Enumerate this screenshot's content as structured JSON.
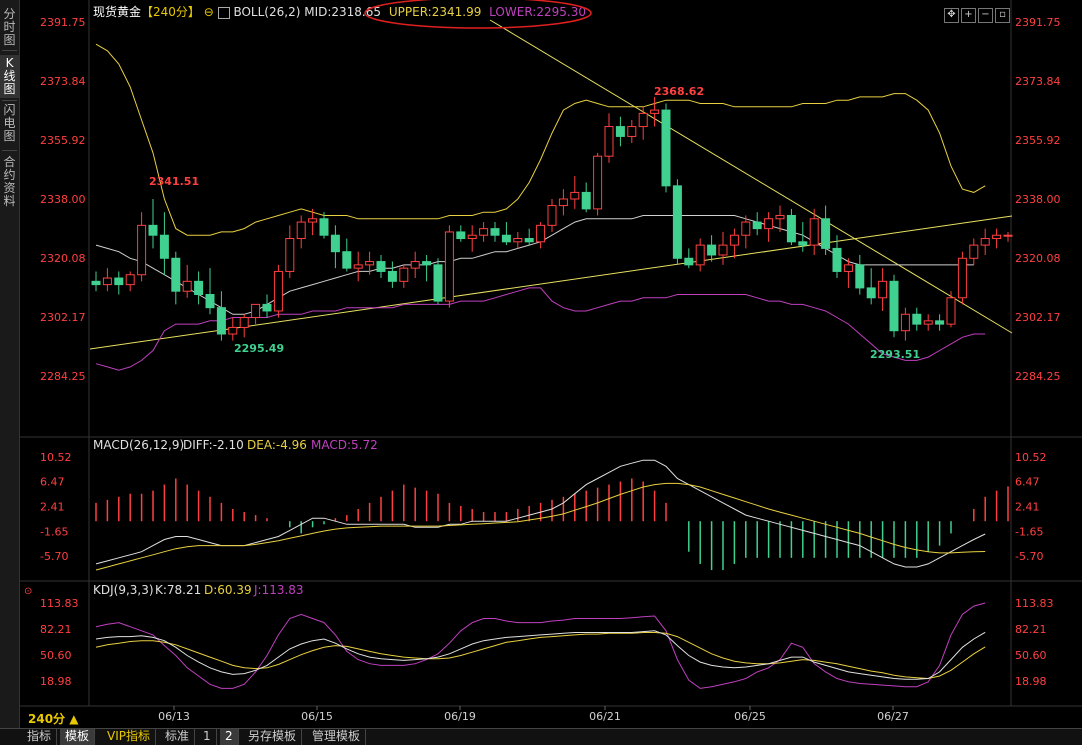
{
  "sidebar": {
    "tabs": [
      {
        "label": "分时图",
        "active": false
      },
      {
        "label": "K线图",
        "active": true
      },
      {
        "label": "闪电图",
        "active": false
      },
      {
        "label": "合约资料",
        "active": false
      }
    ]
  },
  "header": {
    "symbol": "现货黄金",
    "period_tag": "【240分】",
    "indicator": "BOLL(26,2)",
    "mid": "MID:2318.65",
    "upper": "UPPER:2341.99",
    "lower": "LOWER:2295.30"
  },
  "toolbar_icons": [
    "move-icon",
    "zoom-in-icon",
    "zoom-out-icon",
    "restore-icon"
  ],
  "price_axis": {
    "labels": [
      "2391.75",
      "2373.84",
      "2355.92",
      "2338.00",
      "2320.08",
      "2302.17",
      "2284.25"
    ]
  },
  "annotations": {
    "high1": "2341.51",
    "low1": "2295.49",
    "high2": "2368.62",
    "low2": "2293.51"
  },
  "macd": {
    "title": "MACD(26,12,9)",
    "diff": "DIFF:-2.10",
    "dea": "DEA:-4.96",
    "macd": "MACD:5.72",
    "labels": [
      "10.52",
      "6.47",
      "2.41",
      "-1.65",
      "-5.70"
    ]
  },
  "kdj": {
    "title": "KDJ(9,3,3)",
    "k": "K:78.21",
    "d": "D:60.39",
    "j": "J:113.83",
    "labels": [
      "113.83",
      "82.21",
      "50.60",
      "18.98"
    ]
  },
  "x_axis": {
    "labels": [
      "06/13",
      "06/15",
      "06/19",
      "06/21",
      "06/25",
      "06/27"
    ]
  },
  "period_selector": "240分 ▲",
  "bottom_tabs": [
    {
      "label": "指标",
      "active": false
    },
    {
      "label": "模板",
      "active": true
    },
    {
      "label": "VIP指标",
      "active": false
    },
    {
      "label": "标准",
      "active": false
    },
    {
      "label": "1",
      "active": false
    },
    {
      "label": "2",
      "active": true
    },
    {
      "label": "另存模板",
      "active": false
    },
    {
      "label": "管理模板",
      "active": false
    }
  ],
  "colors": {
    "up": "#ff4040",
    "down": "#40d090",
    "upper_band": "#e8d040",
    "lower_band": "#c040c0",
    "mid_band": "#d0d0d0",
    "trendline": "#e8e060",
    "axis_text": "#ff4040"
  },
  "chart_data": {
    "type": "candlestick",
    "price_range": [
      2284.25,
      2391.75
    ],
    "candles": [
      [
        2313,
        2316,
        2310,
        2312
      ],
      [
        2312,
        2317,
        2310,
        2314
      ],
      [
        2314,
        2316,
        2309,
        2312
      ],
      [
        2312,
        2316,
        2310,
        2315
      ],
      [
        2315,
        2334,
        2313,
        2330
      ],
      [
        2330,
        2338,
        2323,
        2327
      ],
      [
        2327,
        2334,
        2315,
        2320
      ],
      [
        2320,
        2322,
        2306,
        2310
      ],
      [
        2310,
        2318,
        2308,
        2313
      ],
      [
        2313,
        2316,
        2306,
        2309
      ],
      [
        2309,
        2317,
        2303,
        2305
      ],
      [
        2305,
        2310,
        2295,
        2297
      ],
      [
        2297,
        2302,
        2295,
        2299
      ],
      [
        2299,
        2303,
        2296,
        2302
      ],
      [
        2302,
        2306,
        2300,
        2306
      ],
      [
        2306,
        2309,
        2302,
        2304
      ],
      [
        2304,
        2318,
        2302,
        2316
      ],
      [
        2316,
        2330,
        2314,
        2326
      ],
      [
        2326,
        2333,
        2323,
        2331
      ],
      [
        2331,
        2335,
        2327,
        2332
      ],
      [
        2332,
        2334,
        2326,
        2327
      ],
      [
        2327,
        2330,
        2317,
        2322
      ],
      [
        2322,
        2326,
        2316,
        2317
      ],
      [
        2317,
        2322,
        2313,
        2318
      ],
      [
        2318,
        2322,
        2315,
        2319
      ],
      [
        2319,
        2321,
        2314,
        2316
      ],
      [
        2316,
        2319,
        2311,
        2313
      ],
      [
        2313,
        2318,
        2311,
        2317
      ],
      [
        2317,
        2322,
        2314,
        2319
      ],
      [
        2319,
        2321,
        2313,
        2318
      ],
      [
        2318,
        2320,
        2306,
        2307
      ],
      [
        2307,
        2330,
        2305,
        2328
      ],
      [
        2328,
        2330,
        2325,
        2326
      ],
      [
        2326,
        2330,
        2322,
        2327
      ],
      [
        2327,
        2331,
        2325,
        2329
      ],
      [
        2329,
        2331,
        2325,
        2327
      ],
      [
        2327,
        2331,
        2324,
        2325
      ],
      [
        2325,
        2328,
        2323,
        2326
      ],
      [
        2326,
        2329,
        2324,
        2325
      ],
      [
        2325,
        2331,
        2323,
        2330
      ],
      [
        2330,
        2338,
        2328,
        2336
      ],
      [
        2336,
        2341,
        2333,
        2338
      ],
      [
        2338,
        2345,
        2335,
        2340
      ],
      [
        2340,
        2343,
        2334,
        2335
      ],
      [
        2335,
        2352,
        2333,
        2351
      ],
      [
        2351,
        2364,
        2349,
        2360
      ],
      [
        2360,
        2363,
        2354,
        2357
      ],
      [
        2357,
        2362,
        2355,
        2360
      ],
      [
        2360,
        2366,
        2356,
        2364
      ],
      [
        2364,
        2369,
        2360,
        2365
      ],
      [
        2365,
        2367,
        2340,
        2342
      ],
      [
        2342,
        2344,
        2318,
        2320
      ],
      [
        2320,
        2323,
        2317,
        2318
      ],
      [
        2318,
        2326,
        2316,
        2324
      ],
      [
        2324,
        2327,
        2319,
        2321
      ],
      [
        2321,
        2328,
        2318,
        2324
      ],
      [
        2324,
        2329,
        2320,
        2327
      ],
      [
        2327,
        2333,
        2323,
        2331
      ],
      [
        2331,
        2334,
        2327,
        2329
      ],
      [
        2329,
        2334,
        2325,
        2332
      ],
      [
        2332,
        2336,
        2328,
        2333
      ],
      [
        2333,
        2335,
        2324,
        2325
      ],
      [
        2325,
        2331,
        2322,
        2324
      ],
      [
        2324,
        2335,
        2321,
        2332
      ],
      [
        2332,
        2336,
        2321,
        2323
      ],
      [
        2323,
        2327,
        2314,
        2316
      ],
      [
        2316,
        2320,
        2311,
        2318
      ],
      [
        2318,
        2321,
        2309,
        2311
      ],
      [
        2311,
        2317,
        2306,
        2308
      ],
      [
        2308,
        2317,
        2304,
        2313
      ],
      [
        2313,
        2315,
        2296,
        2298
      ],
      [
        2298,
        2305,
        2295,
        2303
      ],
      [
        2303,
        2305,
        2298,
        2300
      ],
      [
        2300,
        2303,
        2298,
        2301
      ],
      [
        2301,
        2303,
        2298,
        2300
      ],
      [
        2300,
        2310,
        2299,
        2308
      ],
      [
        2308,
        2322,
        2306,
        2320
      ],
      [
        2320,
        2326,
        2318,
        2324
      ],
      [
        2324,
        2329,
        2321,
        2326
      ],
      [
        2326,
        2329,
        2323,
        2327
      ],
      [
        2327,
        2328,
        2325,
        2327
      ]
    ],
    "boll_upper": [
      2385,
      2383,
      2379,
      2372,
      2362,
      2352,
      2338,
      2329,
      2327,
      2327,
      2327,
      2328,
      2328,
      2329,
      2331,
      2332,
      2333,
      2334,
      2335,
      2334,
      2333,
      2333,
      2333,
      2332,
      2332,
      2332,
      2332,
      2332,
      2332,
      2332,
      2332,
      2333,
      2333,
      2333,
      2334,
      2334,
      2335,
      2338,
      2343,
      2350,
      2358,
      2365,
      2367,
      2368,
      2367,
      2366,
      2366,
      2366,
      2366,
      2367,
      2368,
      2368,
      2368,
      2367,
      2367,
      2367,
      2366,
      2366,
      2366,
      2366,
      2366,
      2366,
      2367,
      2367,
      2367,
      2368,
      2368,
      2369,
      2369,
      2369,
      2370,
      2370,
      2368,
      2365,
      2358,
      2348,
      2341,
      2340,
      2342
    ],
    "boll_mid": [
      2324,
      2323,
      2322,
      2320,
      2319,
      2317,
      2315,
      2313,
      2311,
      2309,
      2307,
      2305,
      2303,
      2303,
      2304,
      2306,
      2308,
      2310,
      2311,
      2312,
      2313,
      2314,
      2315,
      2316,
      2316,
      2317,
      2317,
      2318,
      2318,
      2318,
      2319,
      2319,
      2320,
      2320,
      2321,
      2322,
      2322,
      2323,
      2324,
      2325,
      2327,
      2329,
      2331,
      2332,
      2332,
      2332,
      2332,
      2332,
      2333,
      2333,
      2333,
      2333,
      2333,
      2333,
      2333,
      2333,
      2333,
      2332,
      2331,
      2330,
      2329,
      2328,
      2327,
      2325,
      2323,
      2321,
      2319,
      2318,
      2318,
      2318,
      2318,
      2318,
      2318,
      2318,
      2318,
      2318,
      2318,
      2318
    ],
    "boll_lower": [
      2288,
      2287,
      2286,
      2287,
      2289,
      2292,
      2298,
      2300,
      2300,
      2300,
      2301,
      2301,
      2302,
      2302,
      2302,
      2302,
      2303,
      2303,
      2303,
      2304,
      2304,
      2304,
      2305,
      2305,
      2305,
      2305,
      2305,
      2306,
      2306,
      2306,
      2306,
      2306,
      2307,
      2307,
      2307,
      2308,
      2309,
      2310,
      2311,
      2311,
      2307,
      2305,
      2304,
      2304,
      2305,
      2306,
      2307,
      2307,
      2308,
      2308,
      2308,
      2309,
      2309,
      2309,
      2309,
      2309,
      2309,
      2309,
      2308,
      2307,
      2307,
      2306,
      2306,
      2305,
      2304,
      2302,
      2300,
      2297,
      2294,
      2291,
      2290,
      2289,
      2289,
      2290,
      2292,
      2294,
      2296,
      2297,
      2297
    ],
    "macd_hist": [
      3,
      3.5,
      4,
      4.5,
      4.5,
      5,
      6,
      7,
      6,
      5,
      4,
      3,
      2,
      1.5,
      1,
      0.5,
      0,
      -1,
      -2,
      -1,
      -0.5,
      0.5,
      1,
      2,
      3,
      4,
      5,
      6,
      5.5,
      5,
      4.5,
      3,
      2.5,
      2,
      1.5,
      1.5,
      1.5,
      2,
      2.5,
      3,
      3.5,
      4,
      4.5,
      5,
      5.5,
      6,
      6.5,
      7,
      6.5,
      5,
      3,
      0,
      -5,
      -7,
      -8,
      -8,
      -7,
      -6,
      -6,
      -6,
      -6,
      -6,
      -6,
      -6,
      -6,
      -6,
      -6,
      -6,
      -6,
      -6,
      -6,
      -6,
      -6,
      -5,
      -4,
      -2,
      0,
      2,
      4,
      5,
      5.7
    ],
    "macd_diff": [
      -7,
      -6.5,
      -6,
      -5.5,
      -5,
      -4,
      -3,
      -2.5,
      -2.5,
      -3,
      -3.5,
      -4,
      -4,
      -4,
      -3.5,
      -3,
      -2.5,
      -1.5,
      -0.5,
      0.5,
      0.5,
      0,
      -0.5,
      -0.5,
      -0.5,
      -0.5,
      -0.5,
      -0.5,
      -1,
      -1,
      -1,
      -0.5,
      -0.5,
      0,
      0,
      0,
      0,
      0.5,
      1,
      1.5,
      2,
      3,
      4.5,
      6,
      7,
      8,
      9,
      9.5,
      10,
      10,
      9,
      7,
      6,
      5,
      4,
      3,
      2,
      1,
      0.5,
      0,
      -0.5,
      -1,
      -1.5,
      -2,
      -2.5,
      -3,
      -3.5,
      -4,
      -5,
      -6,
      -7,
      -7.5,
      -7.5,
      -7,
      -6,
      -5,
      -4,
      -3,
      -2.1
    ],
    "macd_dea": [
      -8,
      -7.5,
      -7,
      -6.5,
      -6,
      -5.5,
      -5,
      -4.5,
      -4.2,
      -4,
      -4,
      -4,
      -4,
      -4,
      -3.8,
      -3.5,
      -3.2,
      -2.8,
      -2.4,
      -2,
      -1.6,
      -1.3,
      -1.1,
      -1,
      -0.9,
      -0.8,
      -0.8,
      -0.8,
      -0.8,
      -0.8,
      -0.8,
      -0.7,
      -0.6,
      -0.5,
      -0.4,
      -0.3,
      -0.2,
      -0.1,
      0.2,
      0.5,
      0.8,
      1.2,
      1.8,
      2.4,
      3,
      3.7,
      4.4,
      5,
      5.6,
      6,
      6.2,
      6.2,
      6,
      5.6,
      5,
      4.4,
      3.8,
      3.2,
      2.6,
      2,
      1.5,
      1,
      0.5,
      0,
      -0.5,
      -1,
      -1.5,
      -2,
      -2.6,
      -3.2,
      -3.8,
      -4.3,
      -4.7,
      -5,
      -5.2,
      -5.2,
      -5.1,
      -5,
      -4.96
    ],
    "kdj_k": [
      70,
      72,
      73,
      73,
      74,
      72,
      68,
      60,
      50,
      42,
      35,
      30,
      27,
      28,
      32,
      38,
      48,
      58,
      64,
      68,
      70,
      65,
      58,
      52,
      48,
      46,
      45,
      44,
      45,
      46,
      48,
      52,
      58,
      64,
      68,
      70,
      72,
      73,
      74,
      75,
      76,
      77,
      78,
      78,
      78,
      78,
      78,
      78,
      79,
      80,
      75,
      62,
      50,
      42,
      38,
      36,
      35,
      36,
      38,
      40,
      44,
      48,
      48,
      42,
      38,
      34,
      30,
      28,
      26,
      24,
      22,
      21,
      21,
      22,
      30,
      45,
      60,
      70,
      78.2
    ],
    "kdj_d": [
      60,
      63,
      65,
      67,
      68,
      68,
      66,
      63,
      58,
      53,
      48,
      43,
      38,
      35,
      34,
      35,
      39,
      45,
      51,
      56,
      60,
      62,
      61,
      58,
      55,
      52,
      50,
      48,
      47,
      46,
      46,
      47,
      50,
      54,
      58,
      62,
      66,
      68,
      70,
      72,
      73,
      74,
      75,
      76,
      76,
      77,
      77,
      77,
      78,
      78,
      77,
      73,
      66,
      59,
      52,
      47,
      43,
      41,
      40,
      40,
      41,
      43,
      45,
      44,
      42,
      40,
      37,
      34,
      31,
      29,
      26,
      24,
      23,
      22,
      25,
      32,
      42,
      52,
      60.4
    ],
    "kdj_j": [
      85,
      88,
      90,
      85,
      80,
      75,
      62,
      50,
      35,
      25,
      15,
      10,
      10,
      15,
      30,
      50,
      75,
      95,
      100,
      95,
      90,
      75,
      55,
      45,
      40,
      38,
      38,
      38,
      40,
      45,
      52,
      65,
      80,
      90,
      95,
      95,
      92,
      90,
      90,
      90,
      92,
      93,
      95,
      95,
      95,
      95,
      95,
      96,
      97,
      98,
      80,
      45,
      20,
      10,
      12,
      15,
      18,
      22,
      30,
      35,
      45,
      65,
      60,
      40,
      30,
      22,
      18,
      16,
      15,
      14,
      13,
      12,
      12,
      18,
      38,
      75,
      100,
      110,
      113.8
    ]
  }
}
